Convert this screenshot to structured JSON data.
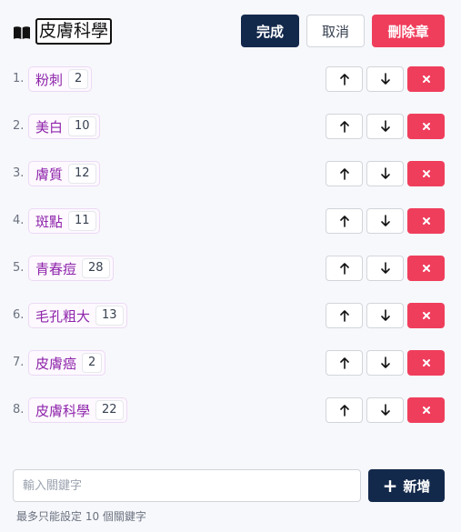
{
  "header": {
    "title": "皮膚科學",
    "done_label": "完成",
    "cancel_label": "取消",
    "delete_chapter_label": "刪除章"
  },
  "keywords": [
    {
      "index": "1.",
      "label": "粉刺",
      "count": "2"
    },
    {
      "index": "2.",
      "label": "美白",
      "count": "10"
    },
    {
      "index": "3.",
      "label": "膚質",
      "count": "12"
    },
    {
      "index": "4.",
      "label": "斑點",
      "count": "11"
    },
    {
      "index": "5.",
      "label": "青春痘",
      "count": "28"
    },
    {
      "index": "6.",
      "label": "毛孔粗大",
      "count": "13"
    },
    {
      "index": "7.",
      "label": "皮膚癌",
      "count": "2"
    },
    {
      "index": "8.",
      "label": "皮膚科學",
      "count": "22"
    }
  ],
  "add": {
    "placeholder": "輸入關鍵字",
    "value": "",
    "button_label": "新增",
    "hint": "最多只能設定 10 個關鍵字"
  },
  "colors": {
    "primary": "#13294b",
    "danger": "#ef3e5c",
    "tag_text": "#8e24aa"
  },
  "icons": [
    "book-icon",
    "arrow-up-icon",
    "arrow-down-icon",
    "close-icon",
    "plus-icon"
  ]
}
